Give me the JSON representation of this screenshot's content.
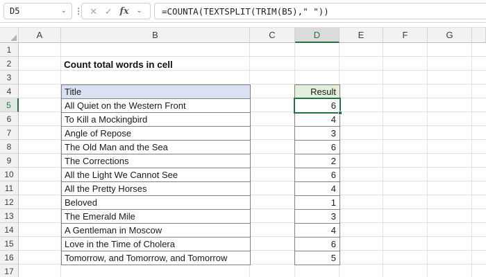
{
  "formula_bar": {
    "cell_reference": "D5",
    "formula": "=COUNTA(TEXTSPLIT(TRIM(B5),\" \"))",
    "cancel_icon": "✕",
    "enter_icon": "✓",
    "fx_label": "fx",
    "dropdown_icon": "⌄",
    "separator_icon": "⋮"
  },
  "sheet": {
    "column_letters": [
      "A",
      "B",
      "C",
      "D",
      "E",
      "F",
      "G"
    ],
    "row_count": 17,
    "selected_column": "D",
    "selected_row": 5,
    "heading_text": "Count total words in cell",
    "table": {
      "title_header": "Title",
      "result_header": "Result",
      "rows": [
        {
          "row": 5,
          "title": "All Quiet on the Western Front",
          "result": "6"
        },
        {
          "row": 6,
          "title": "To Kill a Mockingbird",
          "result": "4"
        },
        {
          "row": 7,
          "title": "Angle of Repose",
          "result": "3"
        },
        {
          "row": 8,
          "title": "The Old Man and the Sea",
          "result": "6"
        },
        {
          "row": 9,
          "title": "The Corrections",
          "result": "2"
        },
        {
          "row": 10,
          "title": "All the Light We Cannot See",
          "result": "6"
        },
        {
          "row": 11,
          "title": "All the Pretty Horses",
          "result": "4"
        },
        {
          "row": 12,
          "title": "Beloved",
          "result": "1"
        },
        {
          "row": 13,
          "title": "The Emerald Mile",
          "result": "3"
        },
        {
          "row": 14,
          "title": "A Gentleman in Moscow",
          "result": "4"
        },
        {
          "row": 15,
          "title": "Love in the Time of Cholera",
          "result": "6"
        },
        {
          "row": 16,
          "title": "Tomorrow, and Tomorrow, and Tomorrow",
          "result": "5"
        }
      ]
    },
    "colors": {
      "selection_green": "#217346",
      "title_header_fill": "#D9E1F2",
      "result_header_fill": "#E2EFDA",
      "table_border": "#808080",
      "gridline": "#E2E2E2"
    }
  }
}
